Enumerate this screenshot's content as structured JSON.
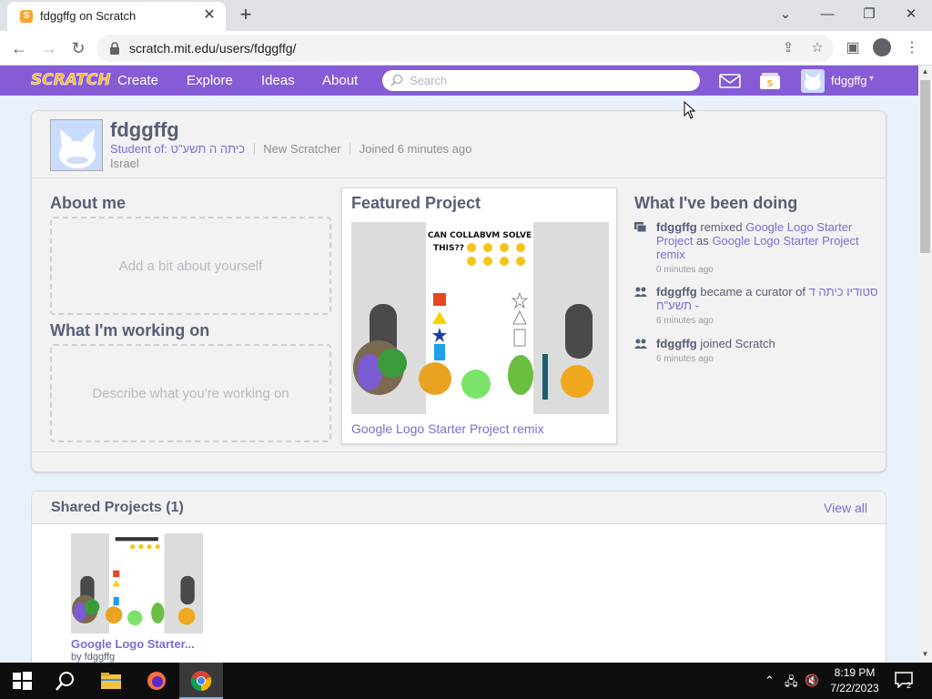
{
  "browser": {
    "tab_title": "fdggffg on Scratch",
    "tab_close": "✕",
    "new_tab": "+",
    "url": "scratch.mit.edu/users/fdggffg/",
    "window_min": "—",
    "window_restore": "❐",
    "window_close": "✕",
    "tab_search": "⌄"
  },
  "nav": {
    "logo": "SCRATCH",
    "links": [
      "Create",
      "Explore",
      "Ideas",
      "About"
    ],
    "search_placeholder": "Search",
    "username": "fdggffg",
    "caret": "▾"
  },
  "profile": {
    "username": "fdggffg",
    "student_of_label": "Student of:",
    "class_name": "כיתה ה תשע\"ט",
    "status": "New Scratcher",
    "joined": "Joined 6 minutes ago",
    "country": "Israel"
  },
  "about": {
    "title": "About me",
    "placeholder": "Add a bit about yourself"
  },
  "working": {
    "title": "What I'm working on",
    "placeholder": "Describe what you're working on"
  },
  "featured": {
    "title": "Featured Project",
    "project_link": "Google Logo Starter Project remix",
    "thumb_text_line1": "CAN COLLABVM SOLVE",
    "thumb_text_line2": "THIS??"
  },
  "activity": {
    "title": "What I've been doing",
    "items": [
      {
        "user": "fdggffg",
        "verb": " remixed ",
        "target": "Google Logo Starter Project",
        "connector": " as ",
        "result": "Google Logo Starter Project remix",
        "time": "0 minutes ago"
      },
      {
        "user": "fdggffg",
        "verb": " became a curator of ",
        "target": "סטודיו כיתה ד תשע\"ח -",
        "time": "6 minutes ago"
      },
      {
        "user": "fdggffg",
        "verb": " joined Scratch",
        "time": "6 minutes ago"
      }
    ]
  },
  "shared": {
    "title": "Shared Projects (1)",
    "view_all": "View all",
    "project_title": "Google Logo Starter...",
    "project_by": "by fdggffg"
  },
  "taskbar": {
    "time": "8:19 PM",
    "date": "7/22/2023",
    "notification_count": "2"
  },
  "colors": {
    "scratch_purple": "#855cd6",
    "link_purple": "#7d6cd6",
    "text_gray": "#575e75",
    "page_bg": "#e9f1fc"
  }
}
